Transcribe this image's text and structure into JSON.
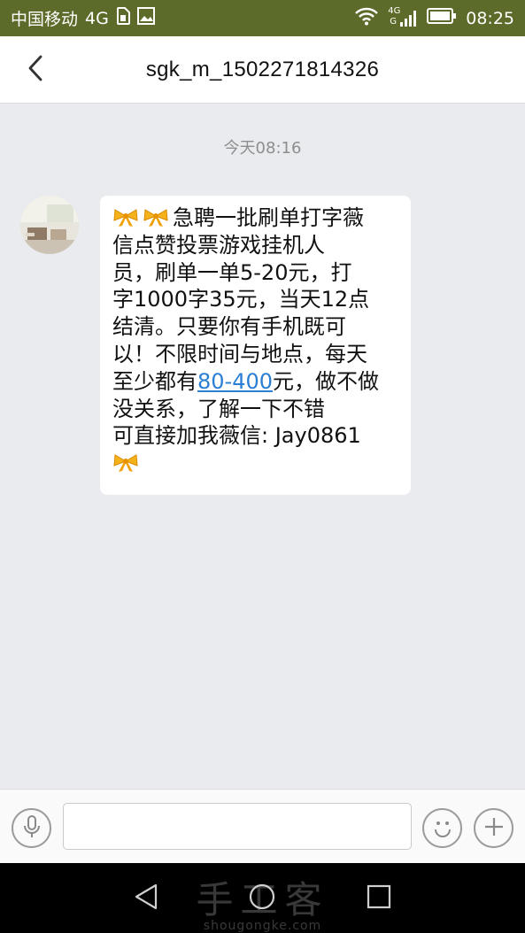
{
  "status_bar": {
    "carrier": "中国移动",
    "network": "4G",
    "signal_label_top": "4G",
    "signal_label_bottom": "G",
    "time": "08:25"
  },
  "header": {
    "title": "sgk_m_1502271814326"
  },
  "conversation": {
    "timestamp": "今天08:16",
    "message": {
      "line1": "急聘一批刷单打字薇",
      "line2": "信点赞投票游戏挂机人",
      "line3": "员，刷单一单5-20元，打",
      "line4": "字1000字35元，当天12点",
      "line5": "结清。只要你有手机既可",
      "line6": "以！不限时间与地点，每天",
      "line7_pre": "至少都有",
      "line7_link": "80-400",
      "line7_post": "元，做不做",
      "line8": "没关系，了解一下不错",
      "line9": "可直接加我薇信: Jay0861"
    }
  },
  "input_bar": {
    "placeholder": "",
    "value": ""
  },
  "watermark": {
    "text": "手工客",
    "url": "shougongke.com"
  },
  "colors": {
    "status_bar_bg": "#5d6b2a",
    "background": "#e9ebee",
    "link": "#2a7fd4"
  }
}
